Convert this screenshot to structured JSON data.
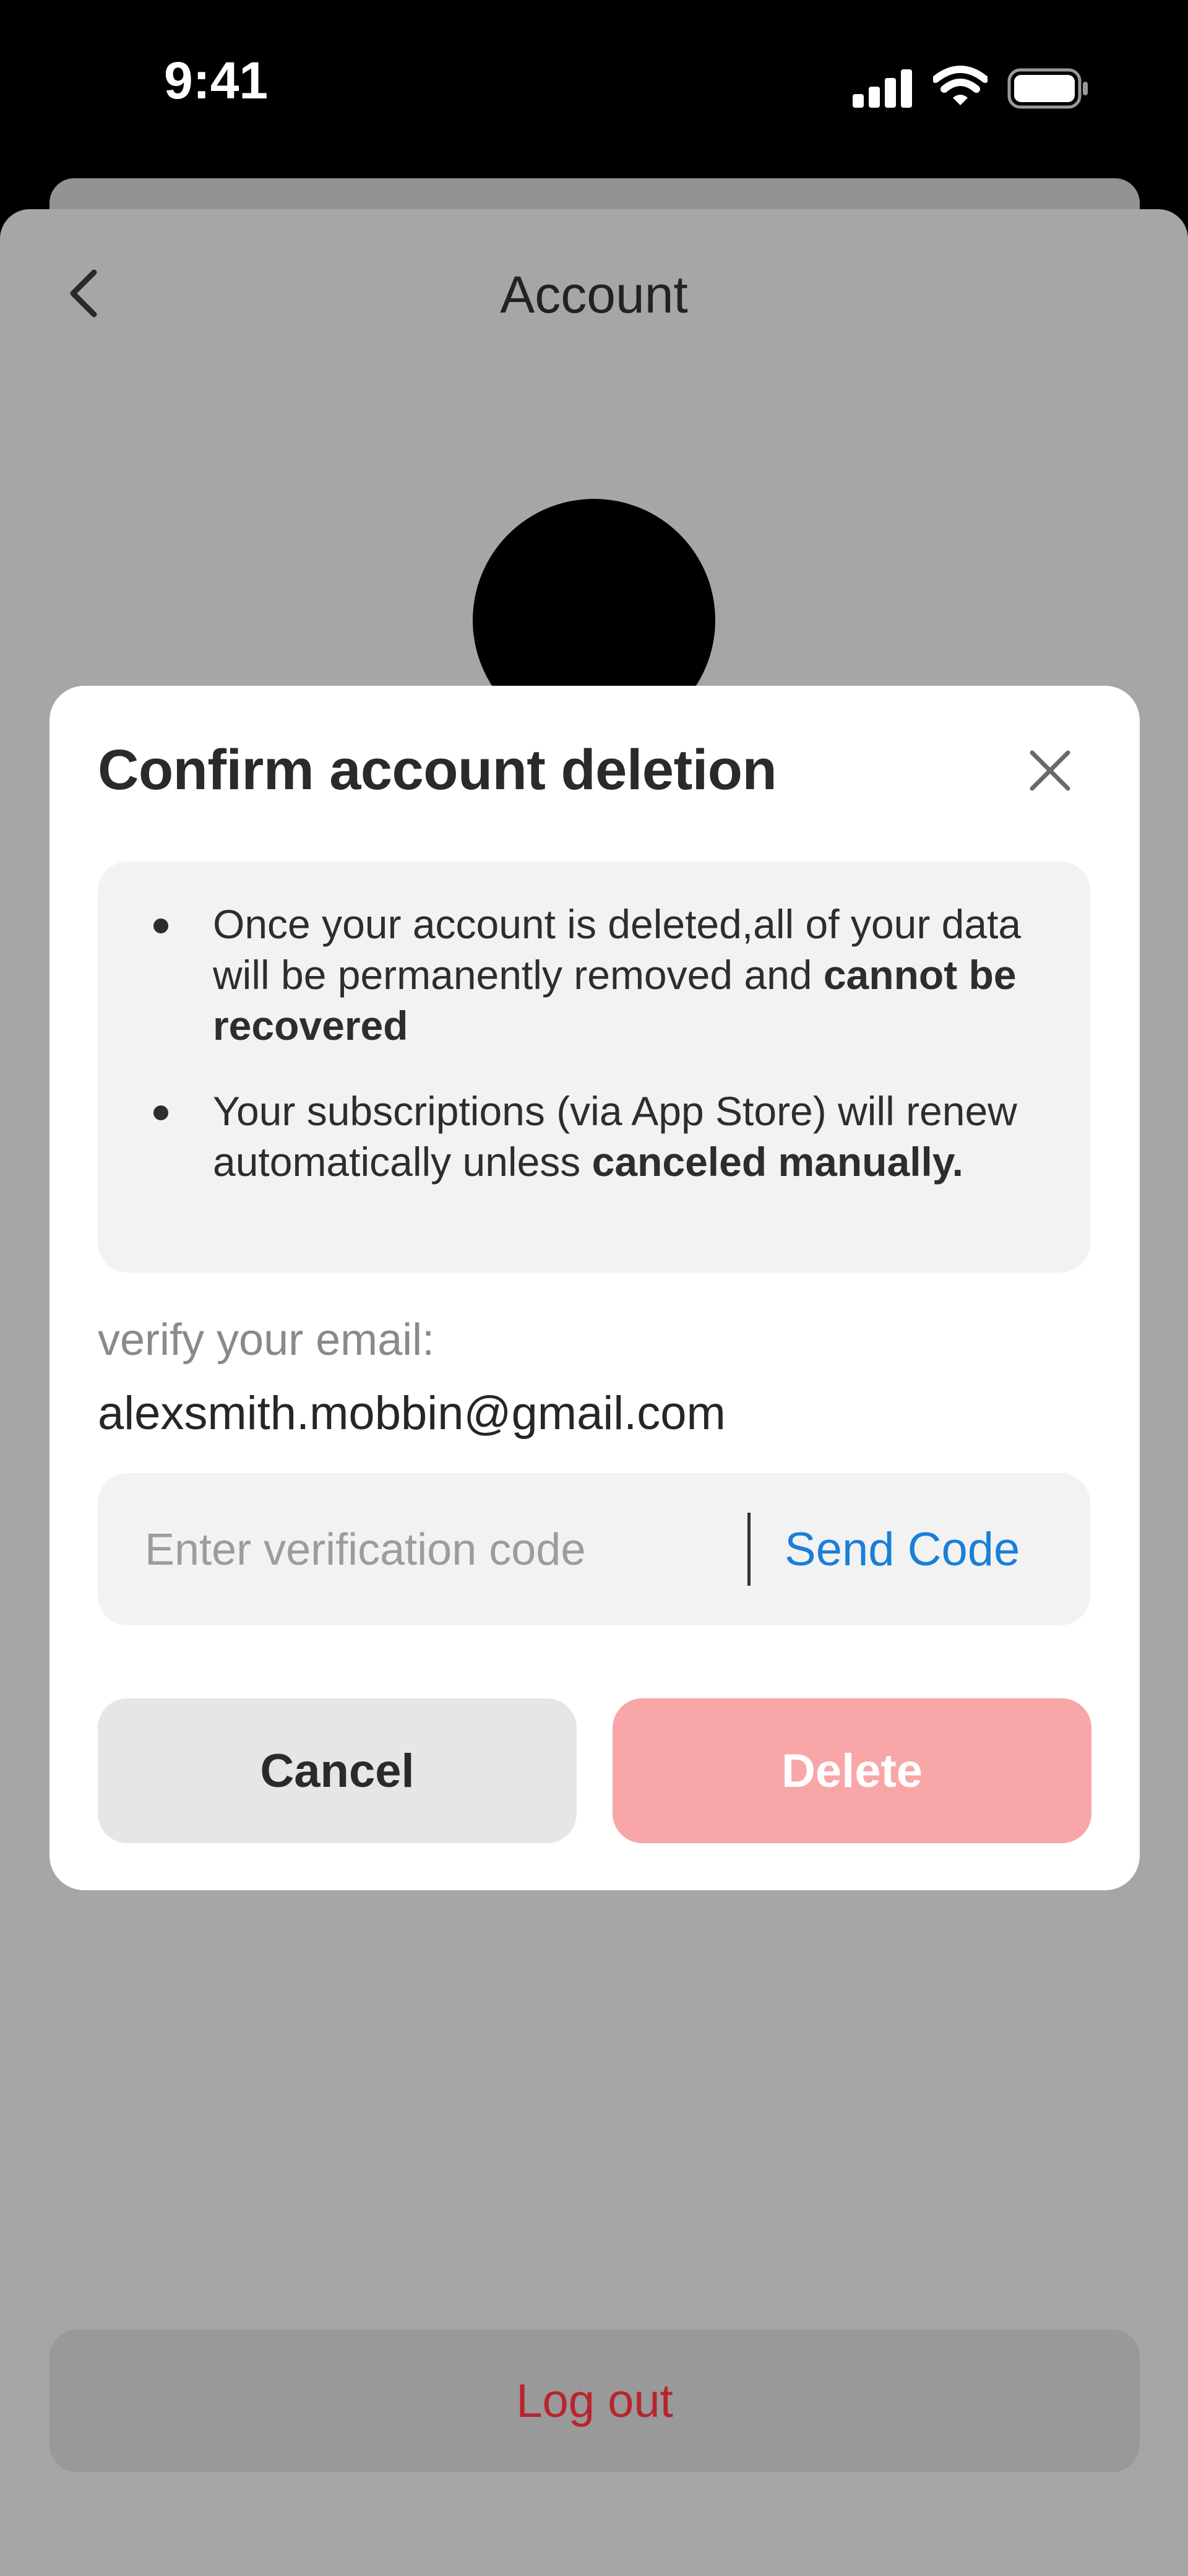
{
  "status_bar": {
    "time": "9:41",
    "icons": [
      "signal-icon",
      "wifi-icon",
      "battery-icon"
    ]
  },
  "header": {
    "title": "Account",
    "back_icon": "chevron-left-icon"
  },
  "modal": {
    "title": "Confirm account deletion",
    "close_icon": "close-icon",
    "bullets": [
      {
        "text": "Once your account is deleted,all of your data will be permanently removed and ",
        "bold": "cannot be recovered"
      },
      {
        "text": "Your subscriptions (via App Store) will renew automatically unless ",
        "bold": "canceled manually."
      }
    ],
    "verify_label": "verify your email:",
    "email": "alexsmith.mobbin@gmail.com",
    "code_placeholder": "Enter verification code",
    "send_code_label": "Send Code",
    "cancel_label": "Cancel",
    "delete_label": "Delete"
  },
  "footer": {
    "logout_label": "Log out"
  },
  "colors": {
    "accent_link": "#1a7fd8",
    "delete_button": "#f9a6a9",
    "logout_text": "#b8242d",
    "overlay": "#a6a6a6"
  }
}
